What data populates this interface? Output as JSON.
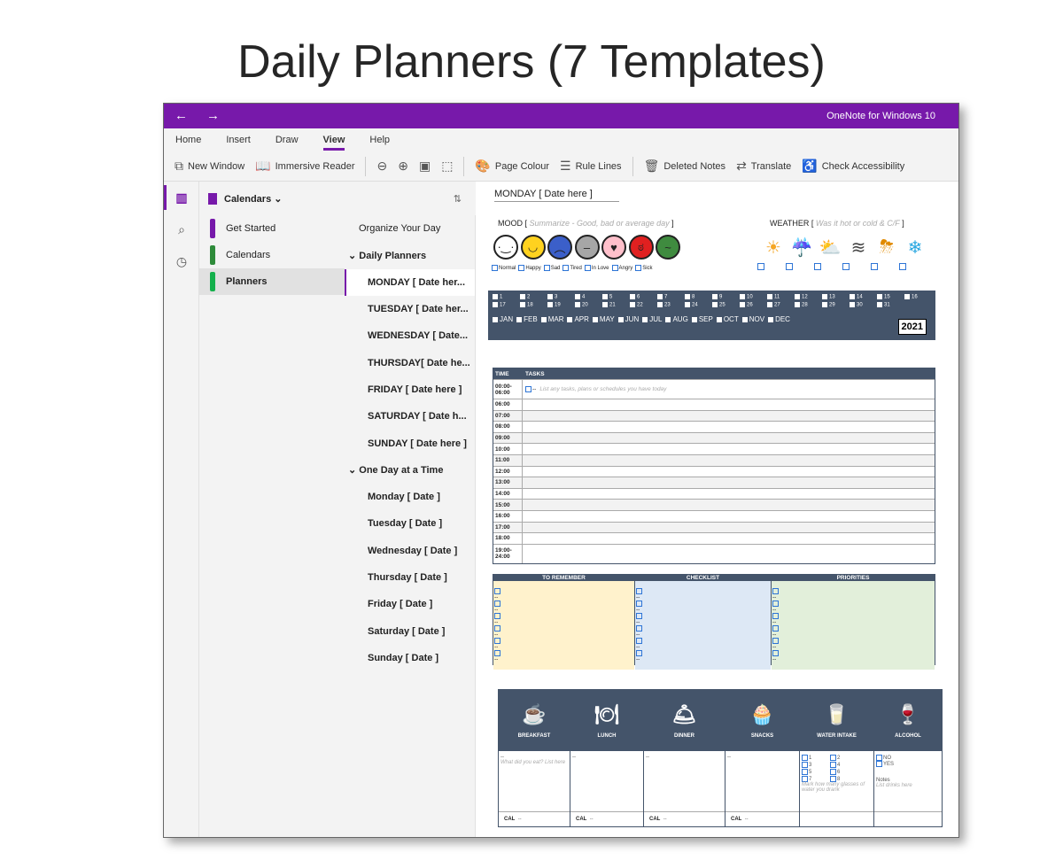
{
  "slide_title": "Daily Planners (7 Templates)",
  "window": {
    "back": "←",
    "forward": "→",
    "app_title": "OneNote for Windows 10"
  },
  "ribbon": {
    "tabs": [
      "Home",
      "Insert",
      "Draw",
      "View",
      "Help"
    ],
    "active_tab": "View"
  },
  "toolbar": {
    "new_window": "New Window",
    "immersive_reader": "Immersive Reader",
    "page_colour": "Page Colour",
    "rule_lines": "Rule Lines",
    "deleted_notes": "Deleted Notes",
    "translate": "Translate",
    "check_accessibility": "Check Accessibility"
  },
  "notebook": {
    "name": "Calendars ⌄"
  },
  "sections": [
    {
      "label": "Get Started",
      "color": "#7719aa"
    },
    {
      "label": "Calendars",
      "color": "#2e8b3a"
    },
    {
      "label": "Planners",
      "color": "#14b04c"
    }
  ],
  "pages": {
    "top": "Organize Your Day",
    "group1": "⌄ Daily Planners",
    "daily": [
      "MONDAY [ Date her...",
      "TUESDAY [ Date her...",
      "WEDNESDAY [ Date...",
      "THURSDAY[ Date he...",
      "FRIDAY [ Date here ]",
      "SATURDAY [ Date h...",
      "SUNDAY [ Date here ]"
    ],
    "group2": "⌄ One Day at a Time",
    "one_day": [
      "Monday [ Date ]",
      "Tuesday [ Date ]",
      "Wednesday [ Date ]",
      "Thursday [ Date ]",
      "Friday [ Date ]",
      "Saturday [ Date ]",
      "Sunday [ Date ]"
    ]
  },
  "canvas": {
    "date_title": "MONDAY [ Date here ]",
    "mood_label": "MOOD [",
    "mood_hint": "Summarize - Good, bad or average day",
    "mood_close": "]",
    "moods": [
      "Normal",
      "Happy",
      "Sad",
      "Tired",
      "In Love",
      "Angry",
      "Sick"
    ],
    "weather_label": "WEATHER [",
    "weather_hint": "Was it hot or cold & C/F",
    "weather_close": "]",
    "days": [
      "1",
      "2",
      "3",
      "4",
      "5",
      "6",
      "7",
      "8",
      "9",
      "10",
      "11",
      "12",
      "13",
      "14",
      "15",
      "16",
      "17",
      "18",
      "19",
      "20",
      "21",
      "22",
      "23",
      "24",
      "25",
      "26",
      "27",
      "28",
      "29",
      "30",
      "31"
    ],
    "months": [
      "JAN",
      "FEB",
      "MAR",
      "APR",
      "MAY",
      "JUN",
      "JUL",
      "AUG",
      "SEP",
      "OCT",
      "NOV",
      "DEC"
    ],
    "year": "2021",
    "schedule": {
      "time_header": "TIME",
      "tasks_header": "TASKS",
      "first_time": "00:00-06:00",
      "first_task_mark": "--",
      "first_task_hint": "List any tasks, plans or schedules you have today",
      "times": [
        "06:00",
        "07:00",
        "08:00",
        "09:00",
        "10:00",
        "11:00",
        "12:00",
        "13:00",
        "14:00",
        "15:00",
        "16:00",
        "17:00",
        "18:00"
      ],
      "last_time": "19:00-24:00"
    },
    "trio": {
      "remember": "TO REMEMBER",
      "checklist": "CHECKLIST",
      "priorities": "PRIORITIES",
      "remember_bg": "#fff2cc",
      "checklist_bg": "#dde8f5",
      "priorities_bg": "#e2efda"
    },
    "meals": {
      "breakfast": "BREAKFAST",
      "lunch": "LUNCH",
      "dinner": "DINNER",
      "snacks": "SNACKS",
      "water": "WATER INTAKE",
      "alcohol": "ALCOHOL",
      "breakfast_hint": "What did you eat? List here",
      "dash": "--",
      "water_hint": "Mark how many glasses of water you drank",
      "water_nums": [
        "1",
        "2",
        "3",
        "4",
        "5",
        "6",
        "7",
        "8"
      ],
      "alcohol_no": "NO",
      "alcohol_yes": "YES",
      "notes": "Notes",
      "notes_hint": "List drinks here",
      "cal": "CAL",
      "cal_dash": "--"
    }
  },
  "colors": {
    "accent": "#7719aa",
    "header_slate": "#44546a"
  }
}
